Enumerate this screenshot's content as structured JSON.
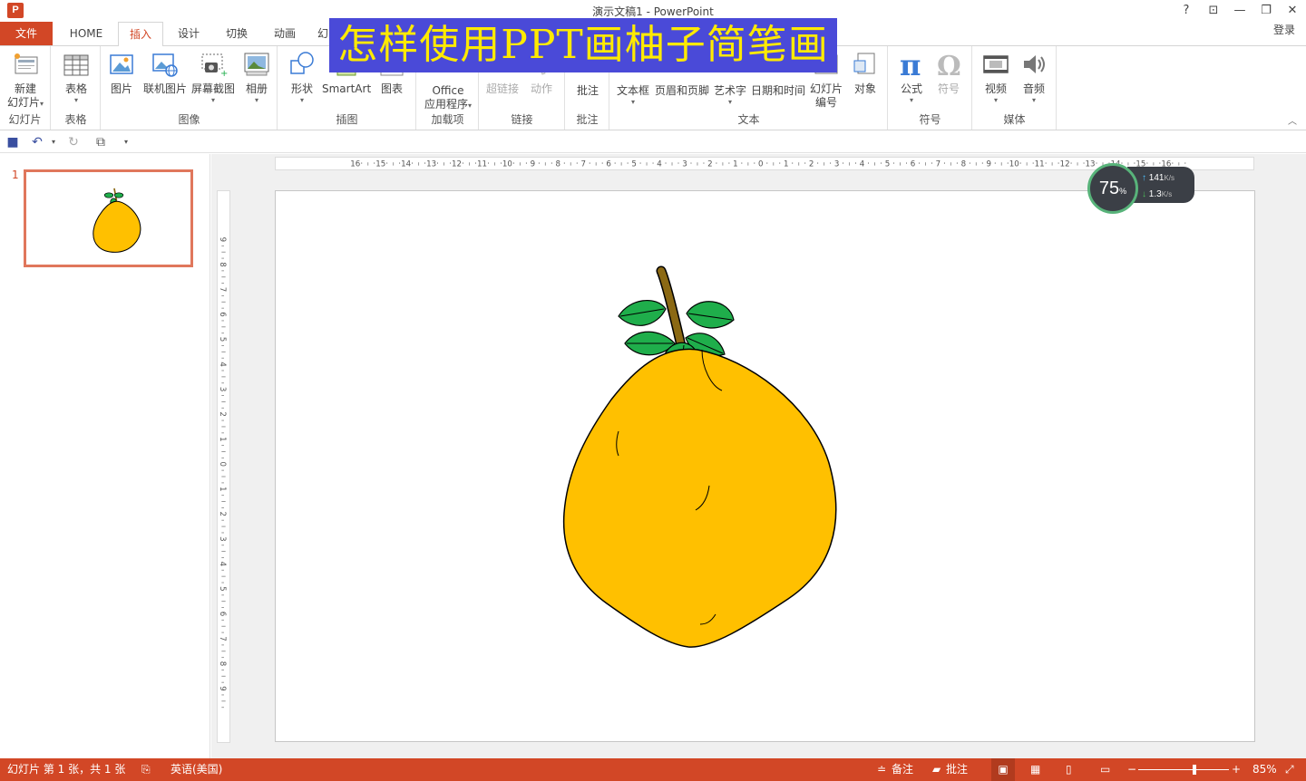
{
  "window": {
    "app_icon": "P",
    "title": "演示文稿1 - PowerPoint",
    "help": "?",
    "ribbon_display": "⊡",
    "minimize": "—",
    "restore": "❐",
    "close": "✕"
  },
  "tabs": {
    "file": "文件",
    "items": [
      "HOME",
      "插入",
      "设计",
      "切换",
      "动画",
      "幻"
    ],
    "active": "插入",
    "login": "登录"
  },
  "banner": "怎样使用PPT画柚子简笔画",
  "ribbon": {
    "groups": {
      "slides": "幻灯片",
      "tables": "表格",
      "images": "图像",
      "illustrations": "插图",
      "addins": "加载项",
      "links": "链接",
      "comments": "批注",
      "text": "文本",
      "symbols": "符号",
      "media": "媒体"
    },
    "buttons": {
      "new_slide_1": "新建",
      "new_slide_2": "幻灯片",
      "table": "表格",
      "picture": "图片",
      "online_picture": "联机图片",
      "screenshot": "屏幕截图",
      "album": "相册",
      "shapes": "形状",
      "smartart": "SmartArt",
      "chart": "图表",
      "office_apps_1": "Office",
      "office_apps_2": "应用程序",
      "hyperlink": "超链接",
      "action": "动作",
      "comment": "批注",
      "textbox": "文本框",
      "header_footer": "页眉和页脚",
      "wordart": "艺术字",
      "date_time": "日期和时间",
      "slide_number_1": "幻灯片",
      "slide_number_2": "编号",
      "object": "对象",
      "equation": "公式",
      "symbol": "符号",
      "video": "视频",
      "audio": "音频"
    }
  },
  "thumbnails": {
    "slide_number": "1"
  },
  "ruler": {
    "h_labels": [
      "16",
      "15",
      "14",
      "13",
      "12",
      "11",
      "10",
      "9",
      "8",
      "7",
      "6",
      "5",
      "4",
      "3",
      "2",
      "1",
      "0",
      "1",
      "2",
      "3",
      "4",
      "5",
      "6",
      "7",
      "8",
      "9",
      "10",
      "11",
      "12",
      "13",
      "14",
      "15",
      "16"
    ],
    "v_labels": [
      "9",
      "8",
      "7",
      "6",
      "5",
      "4",
      "3",
      "2",
      "1",
      "0",
      "1",
      "2",
      "3",
      "4",
      "5",
      "6",
      "7",
      "8",
      "9"
    ]
  },
  "speed_widget": {
    "percent": "75",
    "percent_unit": "%",
    "upload": "141",
    "download": "1.3",
    "unit": "K/s"
  },
  "status": {
    "slide_info": "幻灯片 第 1 张，共 1 张",
    "language": "英语(美国)",
    "notes": "备注",
    "comments": "批注",
    "zoom": "85%",
    "zoom_level": 0.62
  },
  "colors": {
    "accent": "#d24726",
    "fruit": "#ffc000",
    "leaf": "#1fae4b",
    "stem": "#8b6914",
    "banner_bg": "#4a4ad8",
    "banner_text": "#ffea00"
  }
}
